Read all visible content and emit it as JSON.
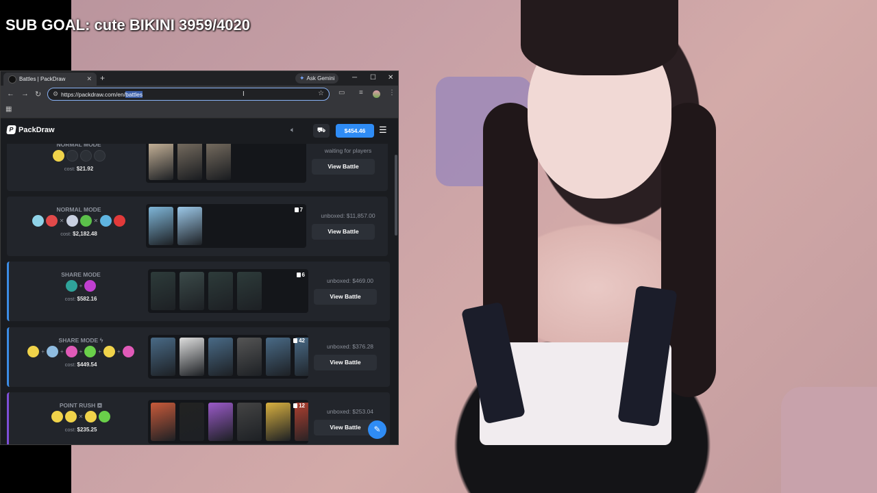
{
  "overlay": {
    "sub_goal": "SUB GOAL: cute BIKINI 3959/4020"
  },
  "browser": {
    "tab_title": "Battles | PackDraw",
    "new_tab_icon": "plus-icon",
    "ask_gemini": "Ask Gemini",
    "url_prefix": "https://packdraw.com/en/",
    "url_selected": "battles"
  },
  "site": {
    "logo_text": "PackDraw",
    "balance": "$454.46",
    "accent_color": "#2f8cf5"
  },
  "battles": [
    {
      "mode": "NORMAL MODE",
      "cost_label": "cost:",
      "cost": "$21.92",
      "count": "",
      "status": "waiting for players",
      "button": "View Battle",
      "players": [
        "#f0d34a",
        "empty",
        "empty",
        "empty"
      ],
      "packs": [
        "#c9b59a",
        "#c9b59a",
        "#c9b59a"
      ]
    },
    {
      "mode": "NORMAL MODE",
      "cost_label": "cost:",
      "cost": "$2,182.48",
      "count": "7",
      "status": "unboxed: $11,857.00",
      "button": "View Battle",
      "players": [
        "#8fd3e8",
        "#e24a4a",
        "#c8cfe0",
        "#5bc04a",
        "#5fb4e0",
        "#e23a3a"
      ],
      "packs": [
        "#7fb6d8",
        "#9cc8e8"
      ]
    },
    {
      "mode": "SHARE MODE",
      "cost_label": "cost:",
      "cost": "$582.16",
      "count": "6",
      "status": "unboxed: $469.00",
      "button": "View Battle",
      "players": [
        "#2fa39a",
        "#c03fd0"
      ],
      "packs": [
        "#2d3b3a",
        "#3b4a49",
        "#2d3b3a",
        "#2d3b3a"
      ]
    },
    {
      "mode": "SHARE MODE",
      "cost_label": "cost:",
      "cost": "$449.54",
      "count": "42",
      "status": "unboxed: $376.28",
      "button": "View Battle",
      "players": [
        "#f0d34a",
        "#8fbce0",
        "#e05ab8",
        "#6ad04a",
        "#f0d34a",
        "#e05ab8"
      ],
      "packs": [
        "#496a86",
        "#ddd",
        "#496a86",
        "#555",
        "#496a86",
        "#496a86"
      ]
    },
    {
      "mode": "POINT RUSH",
      "cost_label": "cost:",
      "cost": "$235.25",
      "count": "12",
      "status": "unboxed: $253.04",
      "button": "View Battle",
      "players": [
        "#f0d34a",
        "#f0d34a",
        "#f0d34a",
        "#6ad04a"
      ],
      "packs": [
        "#c85a3a",
        "#222",
        "#9a5ac8",
        "#444",
        "#d8b040",
        "#b04030"
      ]
    }
  ]
}
